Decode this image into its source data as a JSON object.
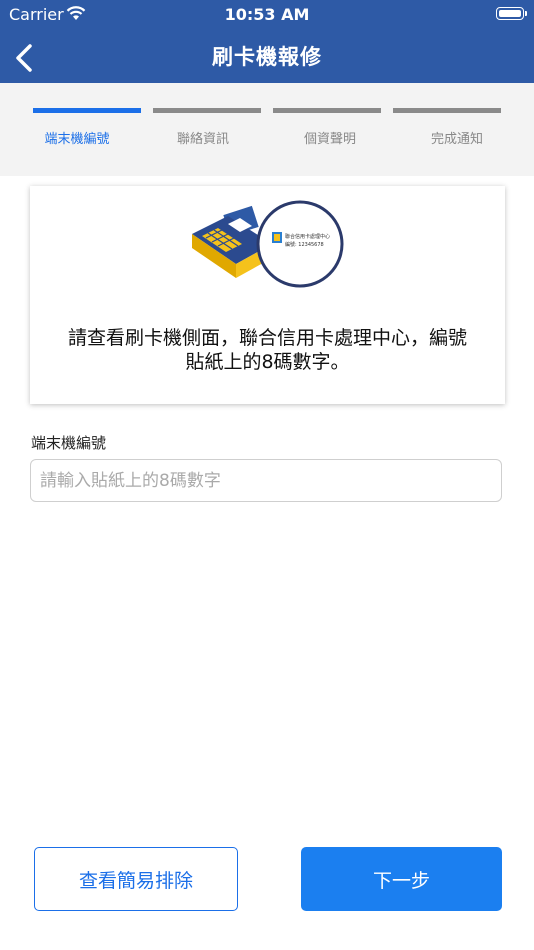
{
  "status_bar": {
    "carrier": "Carrier",
    "time": "10:53 AM"
  },
  "navbar": {
    "title": "刷卡機報修",
    "back_icon": "chevron-left-icon"
  },
  "steps": [
    {
      "label": "端末機編號",
      "active": true
    },
    {
      "label": "聯絡資訊",
      "active": false
    },
    {
      "label": "個資聲明",
      "active": false
    },
    {
      "label": "完成通知",
      "active": false
    }
  ],
  "card": {
    "instruction_line1": "請查看刷卡機側面，聯合信用卡處理中心，編號",
    "instruction_line2": "貼紙上的8碼數字。",
    "sticker_text": "聯合信用卡處理中心",
    "sticker_number": "編號: 12345678"
  },
  "terminal_field": {
    "label": "端末機編號",
    "value": "",
    "placeholder": "請輸入貼紙上的8碼數字"
  },
  "buttons": {
    "troubleshoot_label": "查看簡易排除",
    "next_label": "下一步"
  },
  "colors": {
    "header": "#2e5aa6",
    "accent": "#1b6fe8",
    "primary_button": "#1b7ff0",
    "step_inactive": "#8a8a8a"
  }
}
